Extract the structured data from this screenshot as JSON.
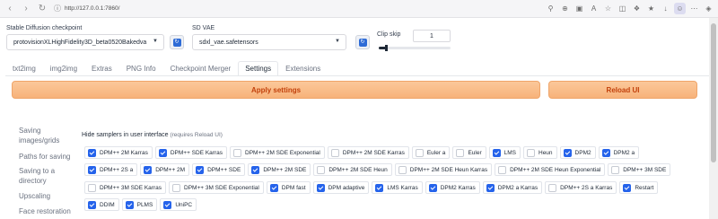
{
  "browser": {
    "url": "http://127.0.0.1:7860/"
  },
  "checkpoint": {
    "label": "Stable Diffusion checkpoint",
    "value": "protovisionXLHighFidelity3D_beta0520Bakedva"
  },
  "vae": {
    "label": "SD VAE",
    "value": "sdxl_vae.safetensors"
  },
  "clip_skip": {
    "label": "Clip skip",
    "value": "1",
    "slider_fraction": 0.1
  },
  "tabs": [
    {
      "label": "txt2img",
      "active": false
    },
    {
      "label": "img2img",
      "active": false
    },
    {
      "label": "Extras",
      "active": false
    },
    {
      "label": "PNG Info",
      "active": false
    },
    {
      "label": "Checkpoint Merger",
      "active": false
    },
    {
      "label": "Settings",
      "active": true
    },
    {
      "label": "Extensions",
      "active": false
    }
  ],
  "actions": {
    "apply": "Apply settings",
    "reload": "Reload UI"
  },
  "sidebar": [
    "Saving images/grids",
    "Paths for saving",
    "Saving to a directory",
    "Upscaling",
    "Face restoration"
  ],
  "samplers_section": {
    "label": "Hide samplers in user interface",
    "hint": "(requires Reload UI)"
  },
  "sampler_rows": [
    [
      {
        "label": "DPM++ 2M Karras",
        "checked": true
      },
      {
        "label": "DPM++ SDE Karras",
        "checked": true
      },
      {
        "label": "DPM++ 2M SDE Exponential",
        "checked": false
      },
      {
        "label": "DPM++ 2M SDE Karras",
        "checked": false
      },
      {
        "label": "Euler a",
        "checked": false
      },
      {
        "label": "Euler",
        "checked": false
      },
      {
        "label": "LMS",
        "checked": true
      },
      {
        "label": "Heun",
        "checked": false
      },
      {
        "label": "DPM2",
        "checked": true
      },
      {
        "label": "DPM2 a",
        "checked": true
      }
    ],
    [
      {
        "label": "DPM++ 2S a",
        "checked": true
      },
      {
        "label": "DPM++ 2M",
        "checked": true
      },
      {
        "label": "DPM++ SDE",
        "checked": true
      },
      {
        "label": "DPM++ 2M SDE",
        "checked": true
      },
      {
        "label": "DPM++ 2M SDE Heun",
        "checked": false
      },
      {
        "label": "DPM++ 2M SDE Heun Karras",
        "checked": false
      },
      {
        "label": "DPM++ 2M SDE Heun Exponential",
        "checked": false
      },
      {
        "label": "DPM++ 3M SDE",
        "checked": false
      }
    ],
    [
      {
        "label": "DPM++ 3M SDE Karras",
        "checked": false
      },
      {
        "label": "DPM++ 3M SDE Exponential",
        "checked": false
      },
      {
        "label": "DPM fast",
        "checked": true
      },
      {
        "label": "DPM adaptive",
        "checked": true
      },
      {
        "label": "LMS Karras",
        "checked": true
      },
      {
        "label": "DPM2 Karras",
        "checked": true
      },
      {
        "label": "DPM2 a Karras",
        "checked": true
      },
      {
        "label": "DPM++ 2S a Karras",
        "checked": false
      },
      {
        "label": "Restart",
        "checked": true
      }
    ],
    [
      {
        "label": "DDIM",
        "checked": true
      },
      {
        "label": "PLMS",
        "checked": true
      },
      {
        "label": "UniPC",
        "checked": true
      }
    ]
  ],
  "colors": {
    "accent_blue": "#2563eb",
    "button_orange": "#f7b27a",
    "button_text": "#c2410c"
  }
}
